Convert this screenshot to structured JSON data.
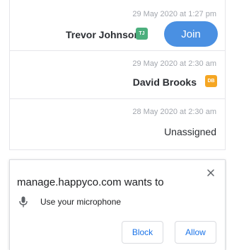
{
  "colors": {
    "join_blue": "#4a90e2",
    "avatar_green": "#4caf7d",
    "avatar_orange": "#f5a623",
    "link_blue": "#1a73e8",
    "muted_gray": "#a3a7ae",
    "border_gray": "#e6e6ea"
  },
  "assignments": [
    {
      "date": "29 May 2020 at 1:27 pm",
      "name": "Trevor Johnson",
      "initials": "TJ",
      "avatar_color": "#4caf7d",
      "action_label": "Join"
    },
    {
      "date": "29 May 2020 at 2:30 am",
      "name": "David Brooks",
      "initials": "DB",
      "avatar_color": "#f5a623"
    },
    {
      "date": "28 May 2020 at 2:30 am",
      "status": "Unassigned"
    }
  ],
  "permission_prompt": {
    "title": "manage.happyco.com wants to",
    "permission_icon": "microphone-icon",
    "permission_text": "Use your microphone",
    "close_icon": "close-icon",
    "block_label": "Block",
    "allow_label": "Allow"
  }
}
